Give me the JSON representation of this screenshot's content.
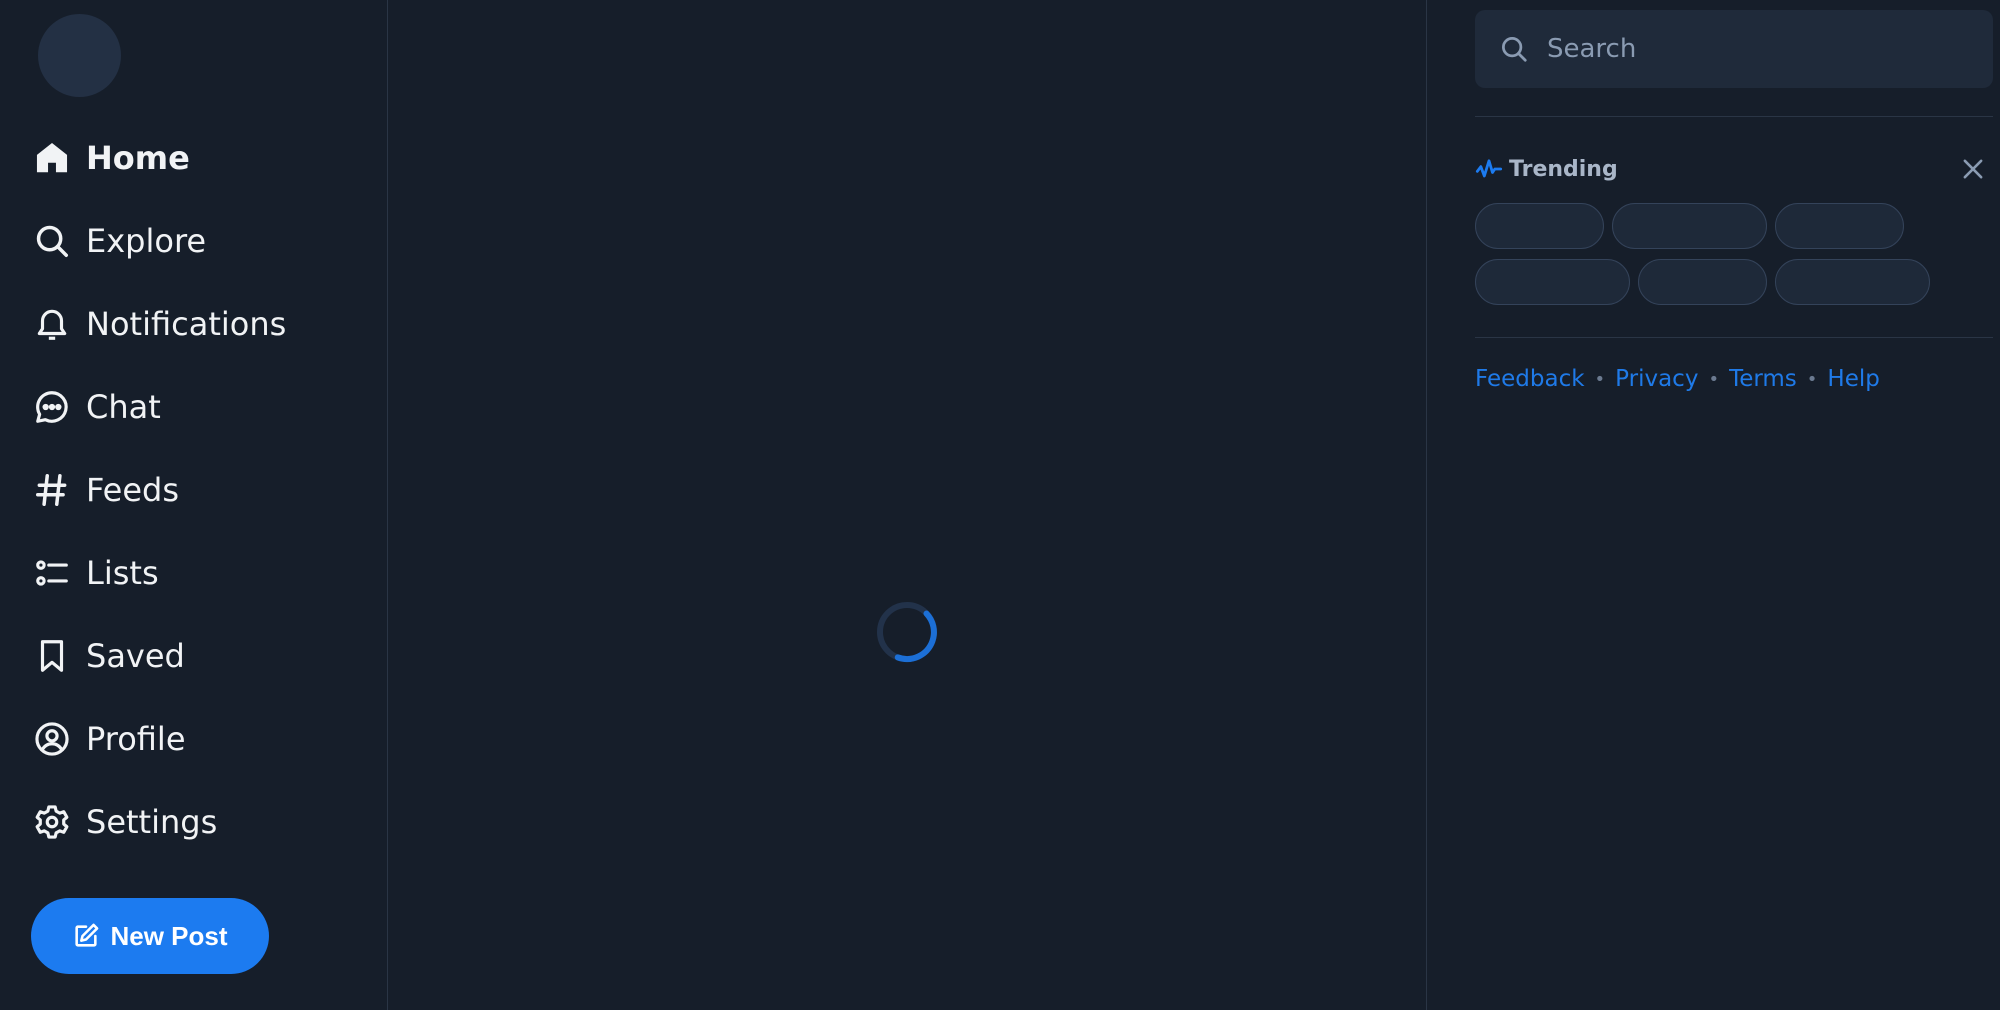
{
  "sidebar": {
    "items": [
      {
        "label": "Home",
        "icon": "home-icon"
      },
      {
        "label": "Explore",
        "icon": "search-icon"
      },
      {
        "label": "Notifications",
        "icon": "bell-icon"
      },
      {
        "label": "Chat",
        "icon": "chat-icon"
      },
      {
        "label": "Feeds",
        "icon": "hashtag-icon"
      },
      {
        "label": "Lists",
        "icon": "list-icon"
      },
      {
        "label": "Saved",
        "icon": "bookmark-icon"
      },
      {
        "label": "Profile",
        "icon": "user-circle-icon"
      },
      {
        "label": "Settings",
        "icon": "gear-icon"
      }
    ],
    "new_post_label": "New Post"
  },
  "right": {
    "search_placeholder": "Search",
    "trending_title": "Trending",
    "footer": [
      "Feedback",
      "Privacy",
      "Terms",
      "Help"
    ]
  },
  "colors": {
    "background": "#161e2a",
    "accent": "#1c7bf0",
    "link": "#1f7ae8"
  }
}
